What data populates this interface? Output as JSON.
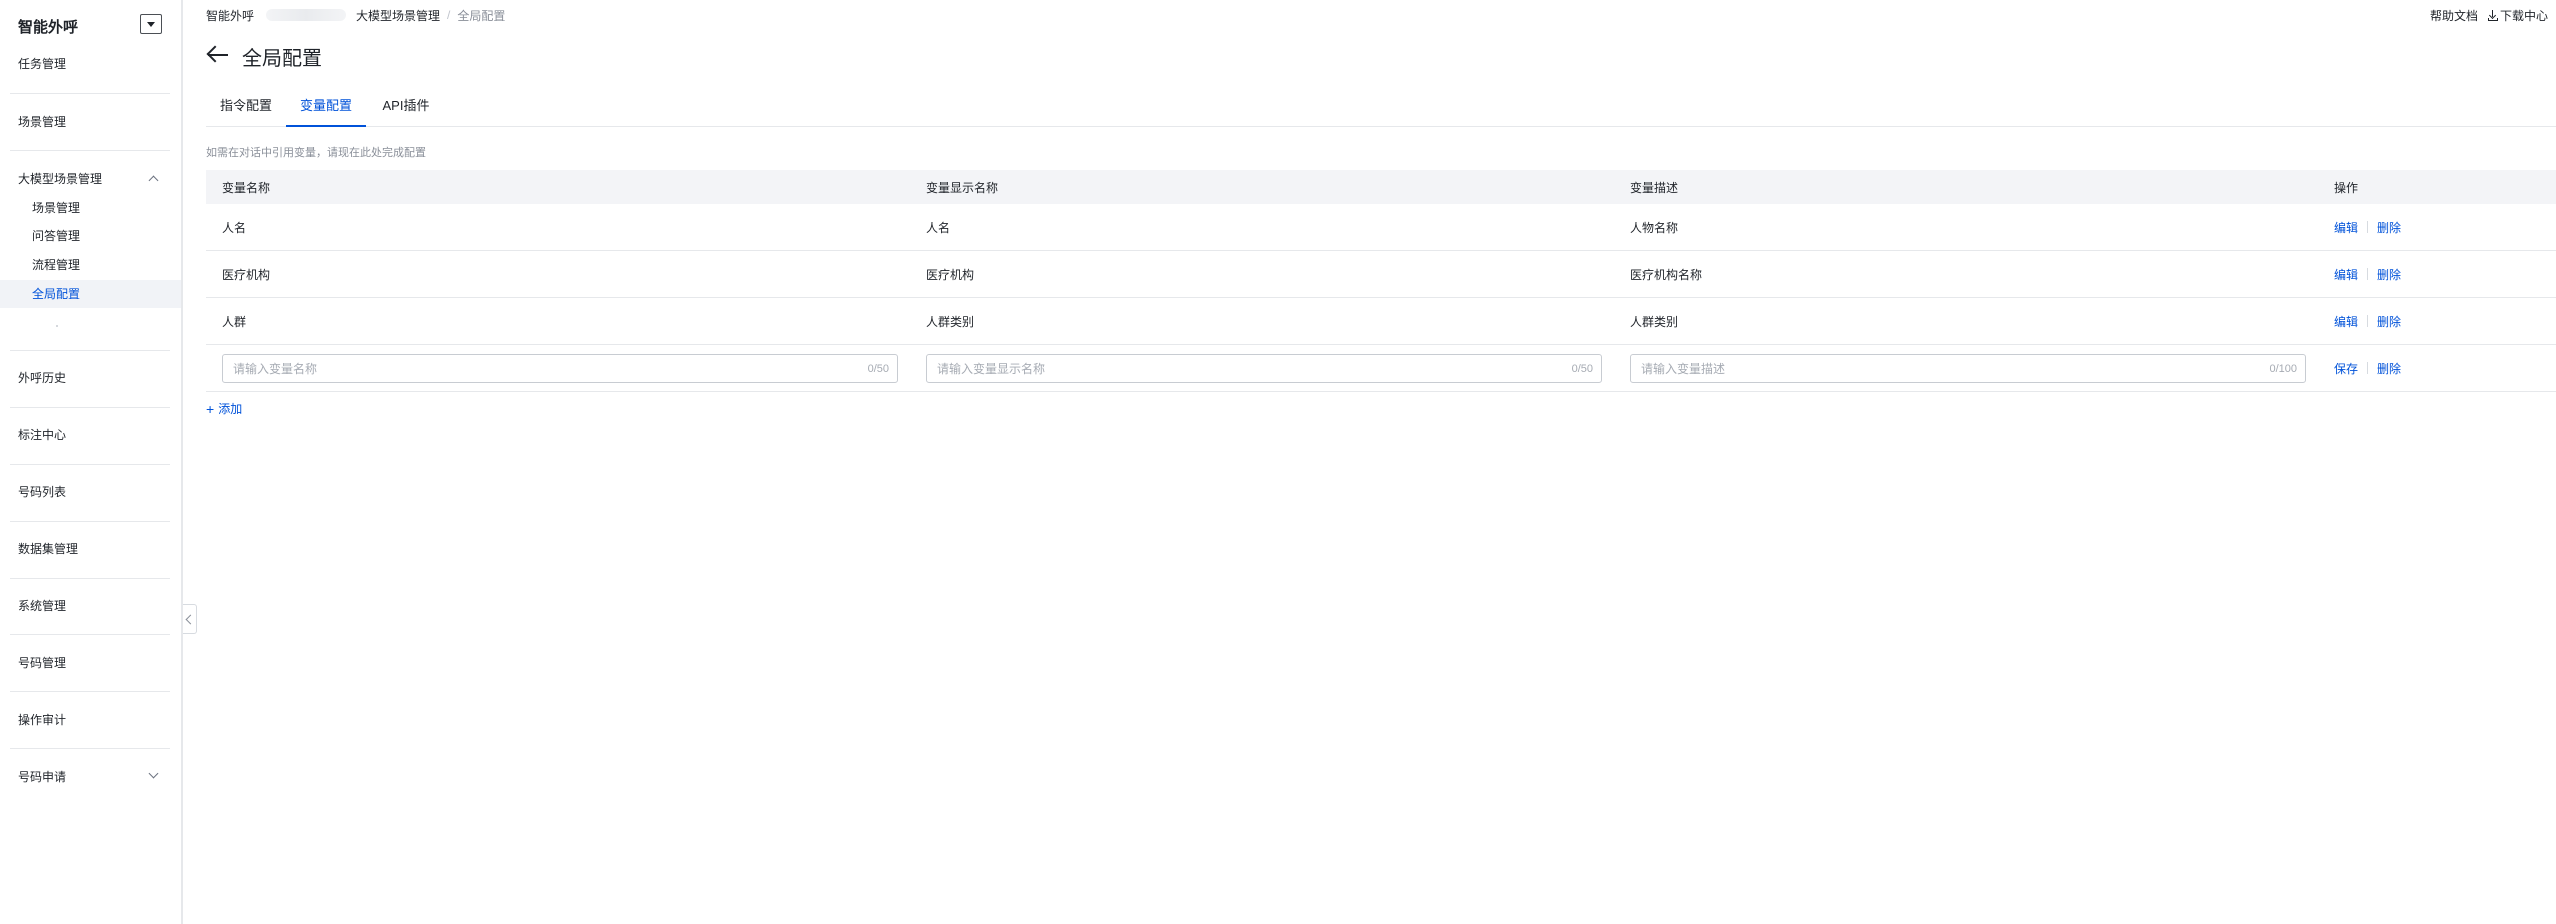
{
  "sidebar": {
    "title": "智能外呼",
    "items": {
      "task": "任务管理",
      "scene": "场景管理",
      "llm_scene": "大模型场景管理",
      "history": "外呼历史",
      "annotation": "标注中心",
      "number_list": "号码列表",
      "dataset": "数据集管理",
      "system": "系统管理",
      "number_mgmt": "号码管理",
      "audit": "操作审计",
      "number_apply": "号码申请"
    },
    "sub_items": {
      "scene": "场景管理",
      "qa": "问答管理",
      "flow": "流程管理",
      "global": "全局配置"
    }
  },
  "breadcrumb": {
    "root": "智能外呼",
    "parent": "大模型场景管理",
    "current": "全局配置"
  },
  "top_links": {
    "help": "帮助文档",
    "download": "下载中心"
  },
  "page": {
    "title": "全局配置",
    "hint": "如需在对话中引用变量，请现在此处完成配置"
  },
  "tabs": [
    "指令配置",
    "变量配置",
    "API插件"
  ],
  "table": {
    "headers": [
      "变量名称",
      "变量显示名称",
      "变量描述",
      "操作"
    ],
    "rows": [
      {
        "name": "人名",
        "display": "人名",
        "desc": "人物名称"
      },
      {
        "name": "医疗机构",
        "display": "医疗机构",
        "desc": "医疗机构名称"
      },
      {
        "name": "人群",
        "display": "人群类别",
        "desc": "人群类别"
      }
    ],
    "actions": {
      "edit": "编辑",
      "delete": "删除",
      "save": "保存"
    },
    "new_row": {
      "name_placeholder": "请输入变量名称",
      "name_counter": "0/50",
      "display_placeholder": "请输入变量显示名称",
      "display_counter": "0/50",
      "desc_placeholder": "请输入变量描述",
      "desc_counter": "0/100"
    }
  },
  "add_label": "添加",
  "colors": {
    "accent": "#0052d9",
    "header_bg": "#f3f4f7",
    "border": "#e6e8eb"
  }
}
